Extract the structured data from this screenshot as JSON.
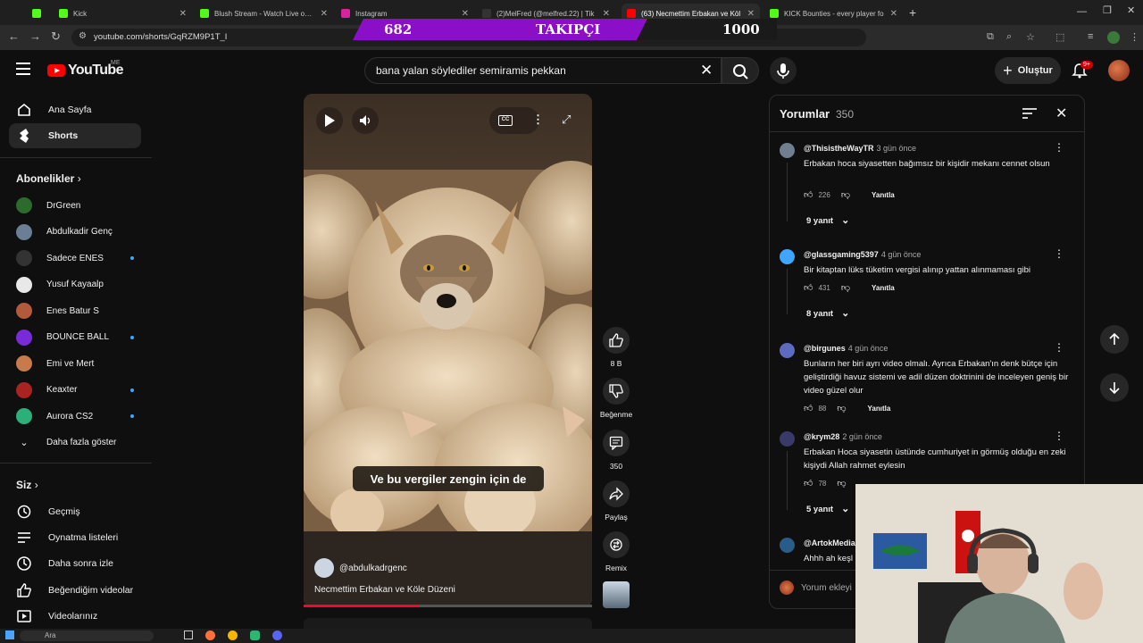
{
  "browser": {
    "tabs": [
      {
        "label": "Kick",
        "color": "#53fc18"
      },
      {
        "label": "Kick",
        "color": "#53fc18"
      },
      {
        "label": "Blush Stream - Watch Live on K",
        "color": "#53fc18"
      },
      {
        "label": "Instagram",
        "color": "#d6249f"
      },
      {
        "label": "(2)MelFred (@melfred.22) | Tik",
        "color": "#000000"
      },
      {
        "label": "(63) Necmettim Erbakan ve Köl",
        "color": "#ff0000"
      },
      {
        "label": "KICK Bounties - every player fo",
        "color": "#53fc18"
      }
    ],
    "url": "youtube.com/shorts/GqRZM9P1T_I"
  },
  "overlay": {
    "count": "682",
    "label": "TAKIPÇI",
    "goal": "1000"
  },
  "header": {
    "logo_text": "YouTube",
    "country": "ME",
    "search_value": "bana yalan söylediler semiramis pekkan",
    "create_label": "Oluştur",
    "notif_badge": "9+"
  },
  "sidebar": {
    "home": "Ana Sayfa",
    "shorts": "Shorts",
    "subs_title": "Abonelikler",
    "subscriptions": [
      {
        "name": "DrGreen",
        "color": "#2b6b2b",
        "dot": false
      },
      {
        "name": "Abdulkadir Genç",
        "color": "#6b7e95",
        "dot": false
      },
      {
        "name": "Sadece ENES",
        "color": "#333333",
        "dot": true
      },
      {
        "name": "Yusuf Kayaalp",
        "color": "#e8e8e8",
        "dot": false
      },
      {
        "name": "Enes Batur S",
        "color": "#b25a3a",
        "dot": false
      },
      {
        "name": "BOUNCE BALL",
        "color": "#7a2bd9",
        "dot": true
      },
      {
        "name": "Emi ve Mert",
        "color": "#c77a4a",
        "dot": false
      },
      {
        "name": "Keaxter",
        "color": "#aa2222",
        "dot": true
      },
      {
        "name": "Aurora CS2",
        "color": "#2bb07a",
        "dot": true
      }
    ],
    "show_more": "Daha fazla göster",
    "you_title": "Siz",
    "you_items": [
      "Geçmiş",
      "Oynatma listeleri",
      "Daha sonra izle",
      "Beğendiğim videolar",
      "Videolarınız"
    ]
  },
  "video": {
    "caption": "Ve bu vergiler zengin için de",
    "channel": "@abdulkadrgenc",
    "title": "Necmettim Erbakan ve Köle Düzeni",
    "progress": 0.4
  },
  "actions": {
    "like": "8 B",
    "dislike": "Beğenme",
    "comments": "350",
    "share": "Paylaş",
    "remix": "Remix"
  },
  "comments": {
    "title": "Yorumlar",
    "count": "350",
    "items": [
      {
        "user": "@ThisistheWayTR",
        "time": "3 gün önce",
        "text": "Erbakan hoca siyasetten bağımsız bir kişidir mekanı cennet olsun",
        "likes": "226",
        "reply": "Yanıtla",
        "replies": "9 yanıt",
        "avatar": "#6f7f8f"
      },
      {
        "user": "@glassgaming5397",
        "time": "4 gün önce",
        "text": "Bir kitaptan lüks tüketim vergisi alınıp yattan alınmaması gibi",
        "likes": "431",
        "reply": "Yanıtla",
        "replies": "8 yanıt",
        "avatar": "#3ea6ff"
      },
      {
        "user": "@birgunes",
        "time": "4 gün önce",
        "text": "Bunların her biri ayrı video olmalı. Ayrıca Erbakan'ın denk bütçe için geliştirdiği havuz sistemi ve adil düzen doktrinini de inceleyen geniş bir video güzel olur",
        "likes": "88",
        "reply": "Yanıtla",
        "replies": "",
        "avatar": "#5c6bc0"
      },
      {
        "user": "@krym28",
        "time": "2 gün önce",
        "text": "Erbakan Hoca siyasetin üstünde cumhuriyet in görmüş olduğu en zeki kişiydi Allah rahmet eylesin",
        "likes": "78",
        "reply": "",
        "replies": "5 yanıt",
        "avatar": "#3a3a6a"
      },
      {
        "user": "@ArtokMedia",
        "time": "",
        "text": "Ahhh ah keşl",
        "likes": "",
        "reply": "",
        "replies": "",
        "avatar": "#2a5c8a"
      }
    ],
    "input_placeholder": "Yorum ekleyi"
  },
  "taskbar": {
    "search": "Ara"
  }
}
